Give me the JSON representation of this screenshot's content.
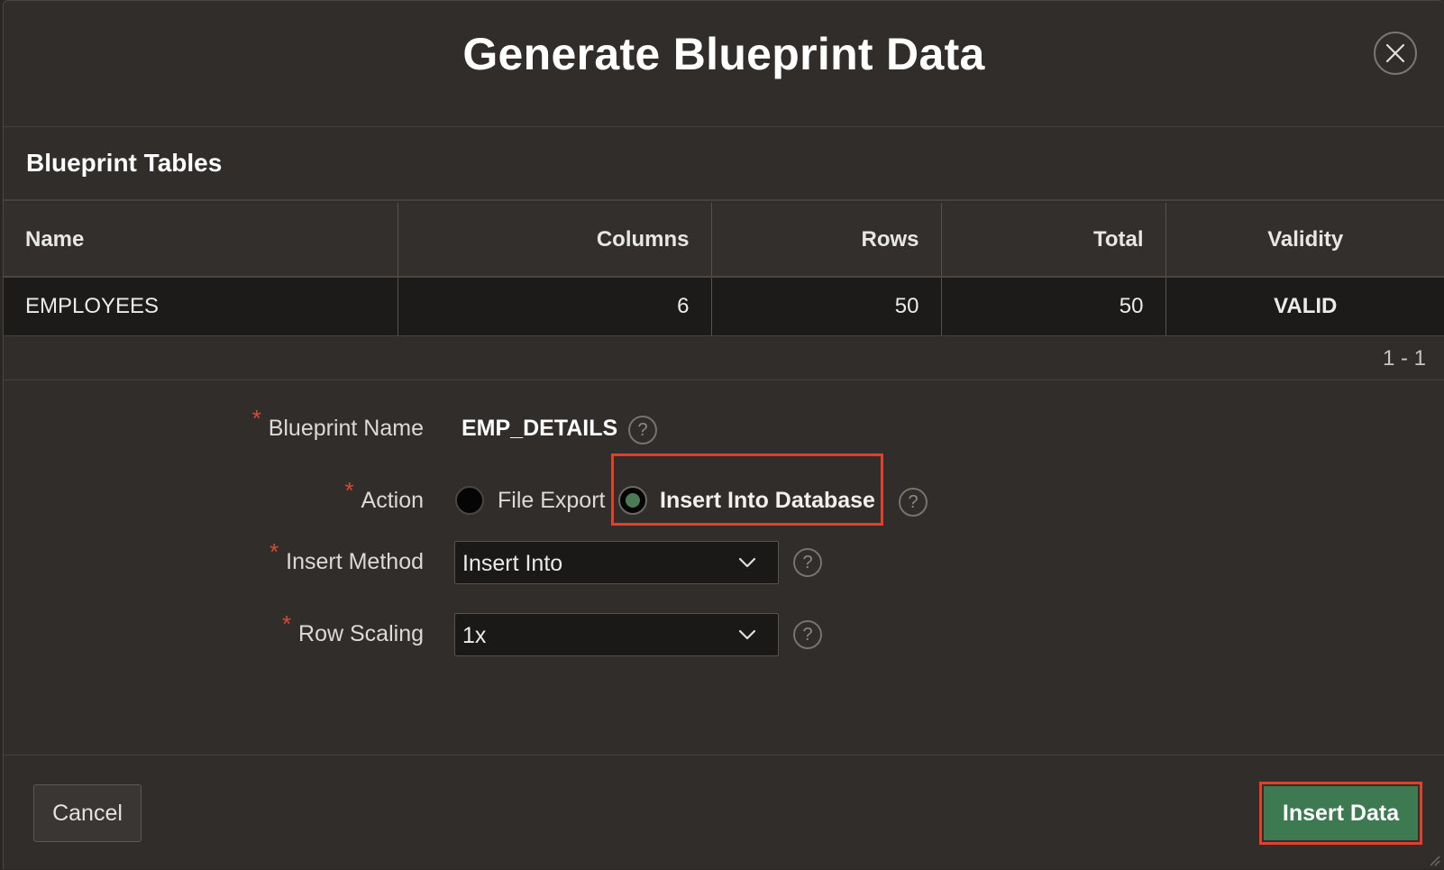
{
  "dialog": {
    "title": "Generate Blueprint Data",
    "close_icon": "close-icon"
  },
  "region": {
    "title": "Blueprint Tables"
  },
  "table": {
    "columns": [
      "Name",
      "Columns",
      "Rows",
      "Total",
      "Validity"
    ],
    "rows": [
      {
        "name": "EMPLOYEES",
        "columns": "6",
        "rows": "50",
        "total": "50",
        "validity": "VALID"
      }
    ],
    "pagination": "1 - 1",
    "validity_color": "#8eaa7e"
  },
  "form": {
    "blueprint_name": {
      "label": "Blueprint Name",
      "value": "EMP_DETAILS",
      "help": "?"
    },
    "action": {
      "label": "Action",
      "options": [
        "File Export",
        "Insert Into Database"
      ],
      "selected": "Insert Into Database",
      "help": "?"
    },
    "insert_method": {
      "label": "Insert Method",
      "value": "Insert Into",
      "help": "?"
    },
    "row_scaling": {
      "label": "Row Scaling",
      "value": "1x",
      "help": "?"
    },
    "required_marker": "*"
  },
  "footer": {
    "cancel_label": "Cancel",
    "primary_label": "Insert Data",
    "primary_color": "#3d7a52",
    "highlight_color": "#e0412a"
  }
}
